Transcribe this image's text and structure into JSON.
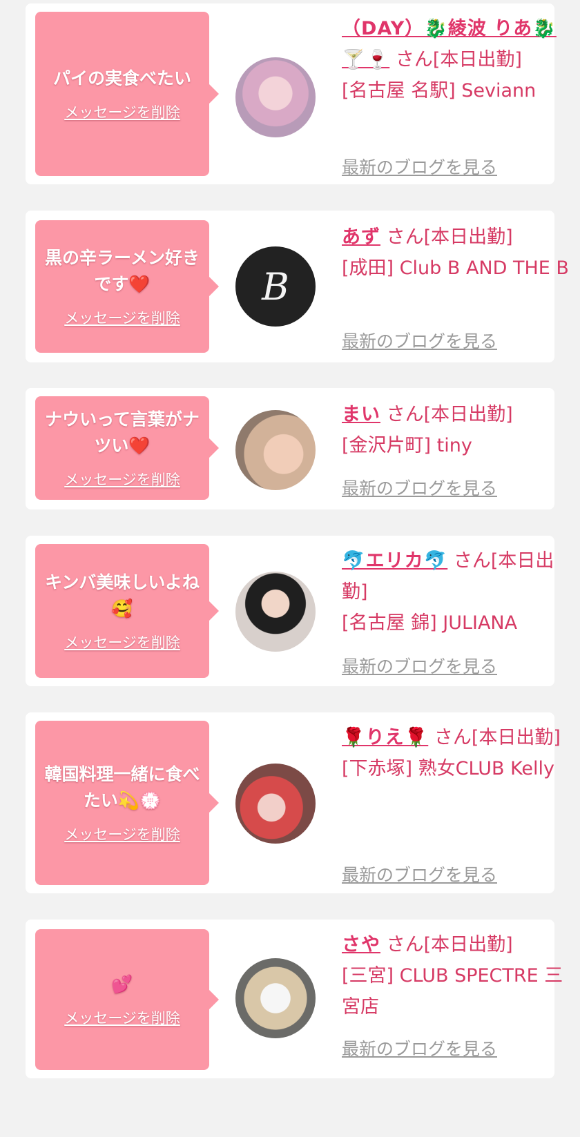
{
  "common": {
    "delete_label": "メッセージを削除",
    "blog_label": "最新のブログを見る",
    "san_suffix": "さん[本日出勤]"
  },
  "items": [
    {
      "message": "パイの実食べたい",
      "name": "（DAY）🐉綾波 りあ🐉🍸🍷",
      "suffix": "さん[本日出勤]",
      "store": "[名古屋 名駅] Seviann"
    },
    {
      "message": "黒の辛ラーメン好きです❤️",
      "name": "あず",
      "suffix": "さん[本日出勤]",
      "store": "[成田] Club B AND THE B",
      "avatar_text": "B"
    },
    {
      "message": "ナウいって言葉がナツい❤️",
      "name": "まい",
      "suffix": "さん[本日出勤]",
      "store": "[金沢片町] tiny"
    },
    {
      "message": "キンバ美味しいよね🥰",
      "name": "🐬エリカ🐬",
      "suffix": "さん[本日出勤]",
      "store": "[名古屋 錦] JULIANA"
    },
    {
      "message": "韓国料理一緒に食べたい💫💮",
      "name": "🌹りえ🌹",
      "suffix": "さん[本日出勤]",
      "store": "[下赤塚] 熟女CLUB Kelly"
    },
    {
      "message": "💕",
      "name": "さや",
      "suffix": "さん[本日出勤]",
      "store": "[三宮] CLUB SPECTRE 三宮店"
    }
  ]
}
